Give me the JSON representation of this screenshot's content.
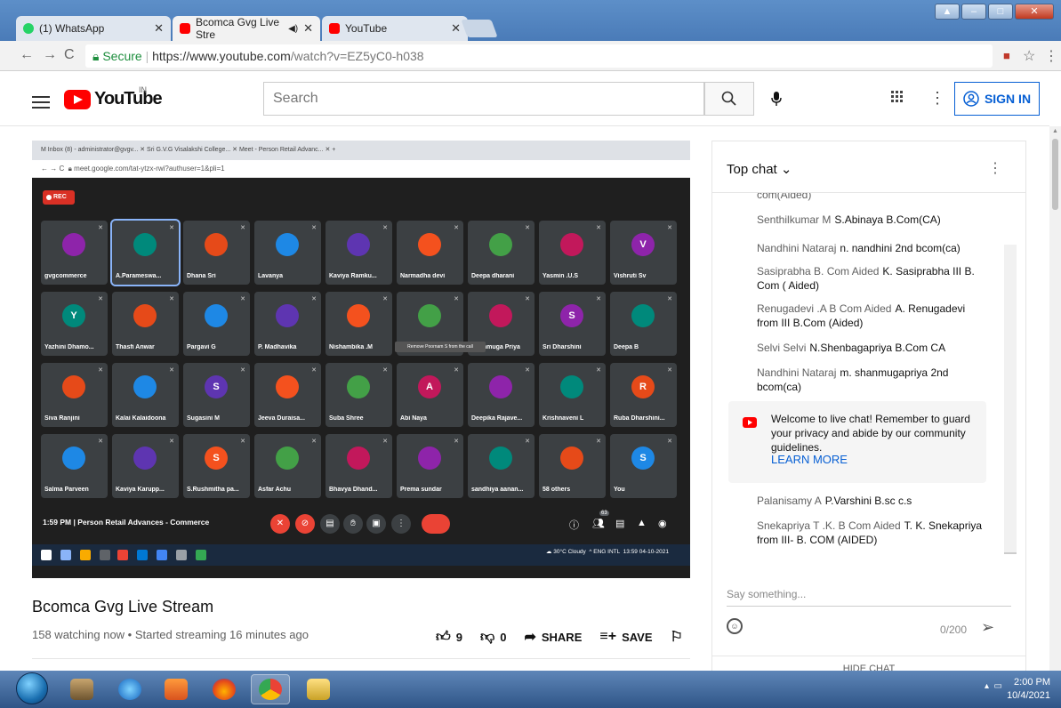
{
  "browser": {
    "tabs": [
      {
        "label": "(1) WhatsApp",
        "icon": "whatsapp-icon",
        "color": "#25d366"
      },
      {
        "label": "Bcomca Gvg Live Stre",
        "icon": "youtube-icon",
        "color": "#ff0000",
        "audio": "◀)"
      },
      {
        "label": "YouTube",
        "icon": "youtube-icon",
        "color": "#ff0000"
      }
    ],
    "url_secure": "Secure",
    "url_host": "https://www.youtube.com",
    "url_path": "/watch?v=EZ5yC0-h038"
  },
  "youtube": {
    "logo_text": "YouTube",
    "region": "IN",
    "search_placeholder": "Search",
    "sign_in": "SIGN IN"
  },
  "video": {
    "inner_tabs": "M Inbox (8) - administrator@gvgv...   ✕   Sri G.V.G Visalakshi College...   ✕   Meet - Person Retail Advanc...   ✕   +",
    "inner_url": "meet.google.com/tat-ytzx-rwi?authuser=1&pli=1",
    "rec": "REC",
    "participants": [
      [
        "gvgcommerce",
        "A.Parameswa...",
        "Dhana Sri",
        "Lavanya",
        "Kaviya Ramku...",
        "Narmadha devi",
        "Deepa dharani",
        "Yasmin .U.S",
        "Vishruti Sv"
      ],
      [
        "Yazhini Dhamo...",
        "Thasfi Anwar",
        "Pargavi G",
        "P. Madhavika",
        "Nishambika .M",
        "Poo",
        "Shanmuga Priya",
        "Sri Dharshini",
        "Deepa B"
      ],
      [
        "Siva Ranjini",
        "Kalai Kalaidoona",
        "Sugasini M",
        "Jeeva Duraisa...",
        "Suba Shree",
        "Abi Naya",
        "Deepika Rajave...",
        "Krishnaveni L",
        "Ruba Dharshini..."
      ],
      [
        "Salma Parveen",
        "Kaviya Karupp...",
        "S.Rushmitha pa...",
        "Asfar Achu",
        "Bhavya Dhand...",
        "Prema sundar",
        "sandhiya aanan...",
        "58 others",
        "You"
      ]
    ],
    "avatars": [
      [
        "",
        "",
        "",
        "",
        "",
        "",
        "",
        "",
        "V"
      ],
      [
        "Y",
        "",
        "",
        "",
        "",
        "",
        "",
        "S",
        ""
      ],
      [
        "",
        "",
        "S",
        "",
        "",
        "A",
        "",
        "",
        "R"
      ],
      [
        "",
        "",
        "S",
        "",
        "",
        "",
        "",
        "",
        "S"
      ]
    ],
    "tooltip": "Remove Poornam S from the call",
    "meet_time": "1:59 PM  |  Person Retail Advances - Commerce",
    "people_count": "63",
    "weather": "30°C Cloudy",
    "lang": "ENG",
    "lang2": "INTL",
    "inner_clock": "13:59",
    "inner_date": "04-10-2021",
    "title": "Bcomca Gvg Live Stream",
    "meta": "158 watching now • Started streaming 16 minutes ago",
    "likes": "9",
    "dislikes": "0",
    "share": "SHARE",
    "save": "SAVE"
  },
  "chat": {
    "header": "Top chat",
    "messages": [
      {
        "author": "",
        "text": "com(Aided)"
      },
      {
        "author": "Senthilkumar M",
        "text": "S.Abinaya B.Com(CA)"
      },
      {
        "author": "Nandhini Nataraj",
        "text": "n. nandhini 2nd bcom(ca)"
      },
      {
        "author": "Sasiprabha B. Com Aided",
        "text": "K. Sasiprabha III B. Com ( Aided)"
      },
      {
        "author": "Renugadevi .A B Com Aided",
        "text": "A. Renugadevi from III B.Com (Aided)"
      },
      {
        "author": "Selvi Selvi",
        "text": "N.Shenbagapriya B.Com CA"
      },
      {
        "author": "Nandhini Nataraj",
        "text": "m. shanmugapriya 2nd bcom(ca)"
      },
      {
        "author": "Palanisamy A",
        "text": "P.Varshini B.sc c.s"
      },
      {
        "author": "Snekapriya T .K. B Com Aided",
        "text": "T. K. Snekapriya from III- B. COM (AIDED)"
      }
    ],
    "welcome": "Welcome to live chat! Remember to guard your privacy and abide by our community guidelines.",
    "learn_more": "LEARN MORE",
    "placeholder": "Say something...",
    "count": "0/200",
    "hide": "HIDE CHAT"
  },
  "taskbar": {
    "time": "2:00 PM",
    "date": "10/4/2021"
  }
}
